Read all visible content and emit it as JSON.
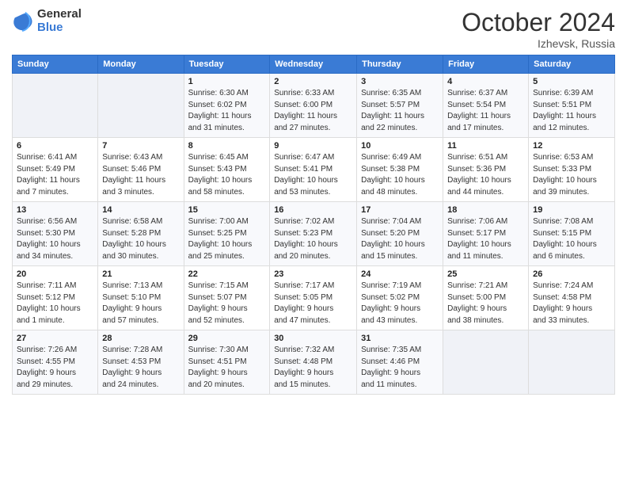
{
  "header": {
    "logo_general": "General",
    "logo_blue": "Blue",
    "month_year": "October 2024",
    "location": "Izhevsk, Russia"
  },
  "days_of_week": [
    "Sunday",
    "Monday",
    "Tuesday",
    "Wednesday",
    "Thursday",
    "Friday",
    "Saturday"
  ],
  "weeks": [
    [
      {
        "day": "",
        "info": ""
      },
      {
        "day": "",
        "info": ""
      },
      {
        "day": "1",
        "info": "Sunrise: 6:30 AM\nSunset: 6:02 PM\nDaylight: 11 hours\nand 31 minutes."
      },
      {
        "day": "2",
        "info": "Sunrise: 6:33 AM\nSunset: 6:00 PM\nDaylight: 11 hours\nand 27 minutes."
      },
      {
        "day": "3",
        "info": "Sunrise: 6:35 AM\nSunset: 5:57 PM\nDaylight: 11 hours\nand 22 minutes."
      },
      {
        "day": "4",
        "info": "Sunrise: 6:37 AM\nSunset: 5:54 PM\nDaylight: 11 hours\nand 17 minutes."
      },
      {
        "day": "5",
        "info": "Sunrise: 6:39 AM\nSunset: 5:51 PM\nDaylight: 11 hours\nand 12 minutes."
      }
    ],
    [
      {
        "day": "6",
        "info": "Sunrise: 6:41 AM\nSunset: 5:49 PM\nDaylight: 11 hours\nand 7 minutes."
      },
      {
        "day": "7",
        "info": "Sunrise: 6:43 AM\nSunset: 5:46 PM\nDaylight: 11 hours\nand 3 minutes."
      },
      {
        "day": "8",
        "info": "Sunrise: 6:45 AM\nSunset: 5:43 PM\nDaylight: 10 hours\nand 58 minutes."
      },
      {
        "day": "9",
        "info": "Sunrise: 6:47 AM\nSunset: 5:41 PM\nDaylight: 10 hours\nand 53 minutes."
      },
      {
        "day": "10",
        "info": "Sunrise: 6:49 AM\nSunset: 5:38 PM\nDaylight: 10 hours\nand 48 minutes."
      },
      {
        "day": "11",
        "info": "Sunrise: 6:51 AM\nSunset: 5:36 PM\nDaylight: 10 hours\nand 44 minutes."
      },
      {
        "day": "12",
        "info": "Sunrise: 6:53 AM\nSunset: 5:33 PM\nDaylight: 10 hours\nand 39 minutes."
      }
    ],
    [
      {
        "day": "13",
        "info": "Sunrise: 6:56 AM\nSunset: 5:30 PM\nDaylight: 10 hours\nand 34 minutes."
      },
      {
        "day": "14",
        "info": "Sunrise: 6:58 AM\nSunset: 5:28 PM\nDaylight: 10 hours\nand 30 minutes."
      },
      {
        "day": "15",
        "info": "Sunrise: 7:00 AM\nSunset: 5:25 PM\nDaylight: 10 hours\nand 25 minutes."
      },
      {
        "day": "16",
        "info": "Sunrise: 7:02 AM\nSunset: 5:23 PM\nDaylight: 10 hours\nand 20 minutes."
      },
      {
        "day": "17",
        "info": "Sunrise: 7:04 AM\nSunset: 5:20 PM\nDaylight: 10 hours\nand 15 minutes."
      },
      {
        "day": "18",
        "info": "Sunrise: 7:06 AM\nSunset: 5:17 PM\nDaylight: 10 hours\nand 11 minutes."
      },
      {
        "day": "19",
        "info": "Sunrise: 7:08 AM\nSunset: 5:15 PM\nDaylight: 10 hours\nand 6 minutes."
      }
    ],
    [
      {
        "day": "20",
        "info": "Sunrise: 7:11 AM\nSunset: 5:12 PM\nDaylight: 10 hours\nand 1 minute."
      },
      {
        "day": "21",
        "info": "Sunrise: 7:13 AM\nSunset: 5:10 PM\nDaylight: 9 hours\nand 57 minutes."
      },
      {
        "day": "22",
        "info": "Sunrise: 7:15 AM\nSunset: 5:07 PM\nDaylight: 9 hours\nand 52 minutes."
      },
      {
        "day": "23",
        "info": "Sunrise: 7:17 AM\nSunset: 5:05 PM\nDaylight: 9 hours\nand 47 minutes."
      },
      {
        "day": "24",
        "info": "Sunrise: 7:19 AM\nSunset: 5:02 PM\nDaylight: 9 hours\nand 43 minutes."
      },
      {
        "day": "25",
        "info": "Sunrise: 7:21 AM\nSunset: 5:00 PM\nDaylight: 9 hours\nand 38 minutes."
      },
      {
        "day": "26",
        "info": "Sunrise: 7:24 AM\nSunset: 4:58 PM\nDaylight: 9 hours\nand 33 minutes."
      }
    ],
    [
      {
        "day": "27",
        "info": "Sunrise: 7:26 AM\nSunset: 4:55 PM\nDaylight: 9 hours\nand 29 minutes."
      },
      {
        "day": "28",
        "info": "Sunrise: 7:28 AM\nSunset: 4:53 PM\nDaylight: 9 hours\nand 24 minutes."
      },
      {
        "day": "29",
        "info": "Sunrise: 7:30 AM\nSunset: 4:51 PM\nDaylight: 9 hours\nand 20 minutes."
      },
      {
        "day": "30",
        "info": "Sunrise: 7:32 AM\nSunset: 4:48 PM\nDaylight: 9 hours\nand 15 minutes."
      },
      {
        "day": "31",
        "info": "Sunrise: 7:35 AM\nSunset: 4:46 PM\nDaylight: 9 hours\nand 11 minutes."
      },
      {
        "day": "",
        "info": ""
      },
      {
        "day": "",
        "info": ""
      }
    ]
  ]
}
